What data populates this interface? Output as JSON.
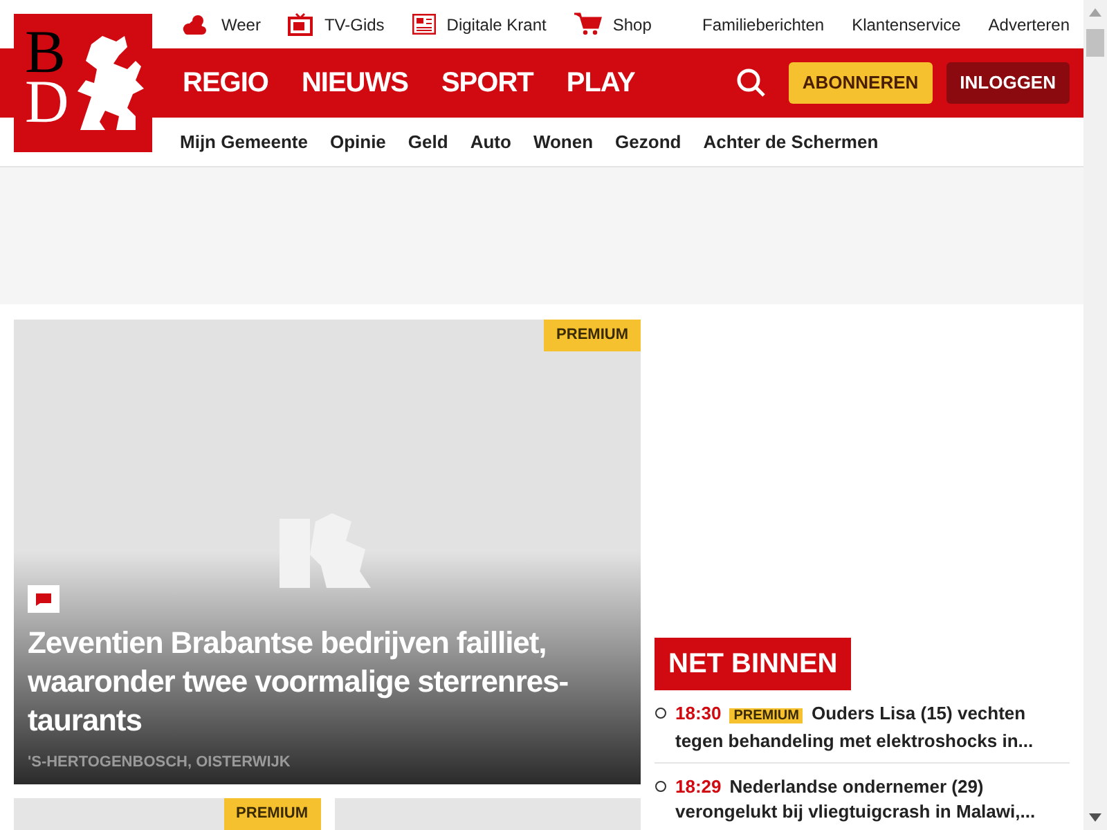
{
  "logo": {
    "letter_top": "B",
    "letter_bottom": "D"
  },
  "utility_links": [
    "Weer",
    "TV-Gids",
    "Digitale Krant",
    "Shop"
  ],
  "service_links": [
    "Familieberichten",
    "Klantenservice",
    "Adverteren"
  ],
  "main_nav": [
    "REGIO",
    "NIEUWS",
    "SPORT",
    "PLAY"
  ],
  "actions": [
    {
      "label": "ABONNEREN",
      "kind": "subscribe"
    },
    {
      "label": "INLOGGEN",
      "kind": "login"
    }
  ],
  "sub_nav": [
    "Mijn Gemeente",
    "Opinie",
    "Geld",
    "Auto",
    "Wonen",
    "Gezond",
    "Achter de Schermen"
  ],
  "hero": {
    "badge": "PREMIUM",
    "has_comments": true,
    "headline": "Zeventien Brabantse bedrijven failliet, waaronder twee voormalige sterrenres-taurants",
    "location": "'S-HERTOGENBOSCH, OISTERWIJK"
  },
  "cards": [
    {
      "premium": true,
      "badge": "PREMIUM"
    },
    {
      "premium": false
    }
  ],
  "net_binnen": {
    "title": "NET BINNEN",
    "items": [
      {
        "time": "18:30",
        "badge": "PREMIUM",
        "headline": "Ouders Lisa (15) vechten tegen behandeling met elektroshocks in..."
      },
      {
        "time": "18:29",
        "headline": "Nederlandse ondernemer (29) verongelukt bij vliegtuigcrash in Malawi,..."
      }
    ]
  }
}
